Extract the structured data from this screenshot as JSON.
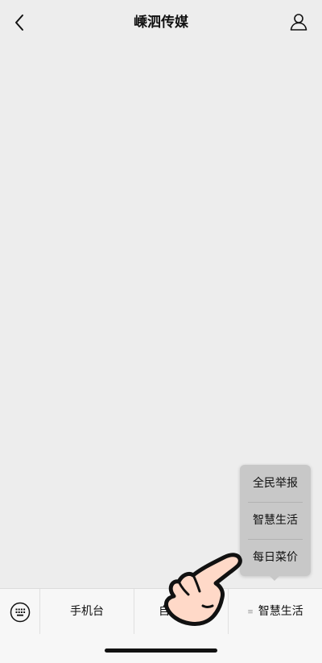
{
  "header": {
    "title": "嵊泗传媒",
    "back_icon": "chevron-left-icon",
    "profile_icon": "person-icon"
  },
  "popup_menu": {
    "items": [
      "全民举报",
      "智慧生活",
      "每日菜价"
    ]
  },
  "bottom_menu": {
    "keyboard_icon": "keyboard-icon",
    "items": [
      {
        "label": "手机台"
      },
      {
        "label": "自在嵊泗"
      },
      {
        "label": "智慧生活",
        "has_submenu": true
      }
    ]
  },
  "colors": {
    "background": "#ededed",
    "menubar": "#f7f7f7",
    "popup": "#c8c8c8"
  }
}
